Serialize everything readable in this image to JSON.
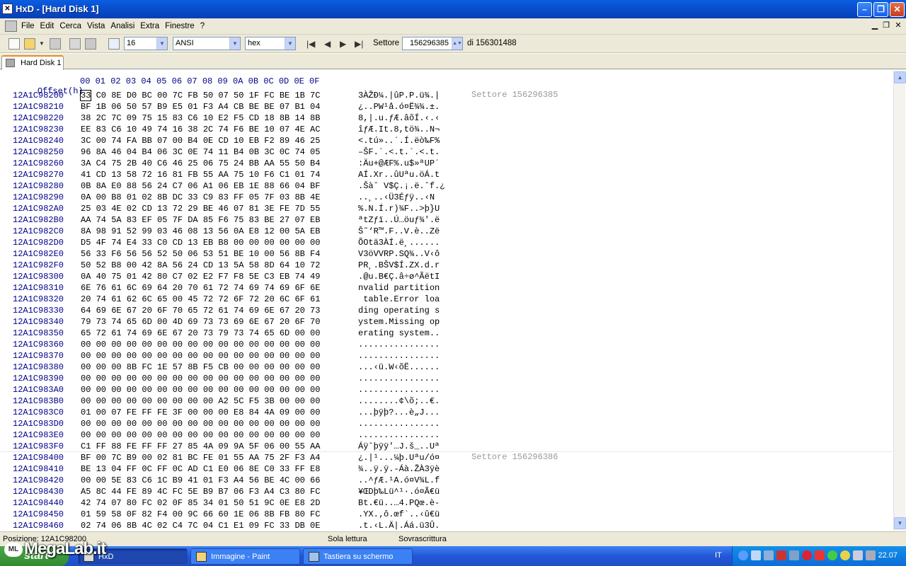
{
  "window": {
    "title": "HxD - [Hard Disk 1]",
    "app_icon": "hxd-icon"
  },
  "menu": [
    "File",
    "Edit",
    "Cerca",
    "Vista",
    "Analisi",
    "Extra",
    "Finestre",
    "?"
  ],
  "toolbar": {
    "bytes_per_row": "16",
    "charset": "ANSI",
    "offset_base": "hex",
    "sector_label": "Settore",
    "sector_value": "156296385",
    "sector_total": "di 156301488"
  },
  "tab": {
    "label": "Hard Disk 1"
  },
  "editor": {
    "offset_header": "Offset(h)",
    "columns": "00 01 02 03 04 05 06 07 08 09 0A 0B 0C 0D 0E 0F",
    "sector1_label": "Settore 156296385",
    "sector2_label": "Settore 156296386",
    "rows": [
      {
        "off": "12A1C98200",
        "hex": "33 C0 8E D0 BC 00 7C FB 50 07 50 1F FC BE 1B 7C",
        "asc": "3ÀŽÐ¼.|ûP.P.ü¾.|"
      },
      {
        "off": "12A1C98210",
        "hex": "BF 1B 06 50 57 B9 E5 01 F3 A4 CB BE BE 07 B1 04",
        "asc": "¿..PW¹å.ó¤Ë¾¾.±."
      },
      {
        "off": "12A1C98220",
        "hex": "38 2C 7C 09 75 15 83 C6 10 E2 F5 CD 18 8B 14 8B",
        "asc": "8,|.u.ƒÆ.âõÍ.‹.‹"
      },
      {
        "off": "12A1C98230",
        "hex": "EE 83 C6 10 49 74 16 38 2C 74 F6 BE 10 07 4E AC",
        "asc": "îƒÆ.It.8,tö¾..N¬"
      },
      {
        "off": "12A1C98240",
        "hex": "3C 00 74 FA BB 07 00 B4 0E CD 10 EB F2 89 46 25",
        "asc": "<.tú»..´.Í.ëò‰F%"
      },
      {
        "off": "12A1C98250",
        "hex": "96 8A 46 04 B4 06 3C 0E 74 11 B4 0B 3C 0C 74 05",
        "asc": "–ŠF.´.<.t.´.<.t."
      },
      {
        "off": "12A1C98260",
        "hex": "3A C4 75 2B 40 C6 46 25 06 75 24 BB AA 55 50 B4",
        "asc": ":Äu+@ÆF%.u$»ªUP´"
      },
      {
        "off": "12A1C98270",
        "hex": "41 CD 13 58 72 16 81 FB 55 AA 75 10 F6 C1 01 74",
        "asc": "AÍ.Xr..ûUªu.öÁ.t"
      },
      {
        "off": "12A1C98280",
        "hex": "0B 8A E0 88 56 24 C7 06 A1 06 EB 1E 88 66 04 BF",
        "asc": ".Šàˆ V$Ç.¡.ë.ˆf.¿"
      },
      {
        "off": "12A1C98290",
        "hex": "0A 00 B8 01 02 8B DC 33 C9 83 FF 05 7F 03 8B 4E",
        "asc": "..¸..‹Ü3Éƒÿ..‹N"
      },
      {
        "off": "12A1C982A0",
        "hex": "25 03 4E 02 CD 13 72 29 BE 46 07 81 3E FE 7D 55",
        "asc": "%.N.Í.r)¾F..>þ}U"
      },
      {
        "off": "12A1C982B0",
        "hex": "AA 74 5A 83 EF 05 7F DA 85 F6 75 83 BE 27 07 EB",
        "asc": "ªtZƒï..Ú…öuƒ¾'.ë"
      },
      {
        "off": "12A1C982C0",
        "hex": "8A 98 91 52 99 03 46 08 13 56 0A E8 12 00 5A EB",
        "asc": "Š˜‘R™.F..V.è..Zë"
      },
      {
        "off": "12A1C982D0",
        "hex": "D5 4F 74 E4 33 C0 CD 13 EB B8 00 00 00 00 00 00",
        "asc": "ÕOtä3ÀÍ.ë¸......"
      },
      {
        "off": "12A1C982E0",
        "hex": "56 33 F6 56 56 52 50 06 53 51 BE 10 00 56 8B F4",
        "asc": "V3öVVRP.SQ¾..V‹ô"
      },
      {
        "off": "12A1C982F0",
        "hex": "50 52 B8 00 42 8A 56 24 CD 13 5A 58 8D 64 10 72",
        "asc": "PR¸.BŠV$Í.ZX.d.r"
      },
      {
        "off": "12A1C98300",
        "hex": "0A 40 75 01 42 80 C7 02 E2 F7 F8 5E C3 EB 74 49",
        "asc": ".@u.B€Ç.â÷ø^ÃëtI"
      },
      {
        "off": "12A1C98310",
        "hex": "6E 76 61 6C 69 64 20 70 61 72 74 69 74 69 6F 6E",
        "asc": "nvalid partition"
      },
      {
        "off": "12A1C98320",
        "hex": "20 74 61 62 6C 65 00 45 72 72 6F 72 20 6C 6F 61",
        "asc": " table.Error loa"
      },
      {
        "off": "12A1C98330",
        "hex": "64 69 6E 67 20 6F 70 65 72 61 74 69 6E 67 20 73",
        "asc": "ding operating s"
      },
      {
        "off": "12A1C98340",
        "hex": "79 73 74 65 6D 00 4D 69 73 73 69 6E 67 20 6F 70",
        "asc": "ystem.Missing op"
      },
      {
        "off": "12A1C98350",
        "hex": "65 72 61 74 69 6E 67 20 73 79 73 74 65 6D 00 00",
        "asc": "erating system.."
      },
      {
        "off": "12A1C98360",
        "hex": "00 00 00 00 00 00 00 00 00 00 00 00 00 00 00 00",
        "asc": "................"
      },
      {
        "off": "12A1C98370",
        "hex": "00 00 00 00 00 00 00 00 00 00 00 00 00 00 00 00",
        "asc": "................"
      },
      {
        "off": "12A1C98380",
        "hex": "00 00 00 8B FC 1E 57 8B F5 CB 00 00 00 00 00 00",
        "asc": "...‹ü.W‹õË......"
      },
      {
        "off": "12A1C98390",
        "hex": "00 00 00 00 00 00 00 00 00 00 00 00 00 00 00 00",
        "asc": "................"
      },
      {
        "off": "12A1C983A0",
        "hex": "00 00 00 00 00 00 00 00 00 00 00 00 00 00 00 00",
        "asc": "................"
      },
      {
        "off": "12A1C983B0",
        "hex": "00 00 00 00 00 00 00 00 00 A2 5C F5 3B 00 00 00",
        "asc": "........¢\\õ;..€."
      },
      {
        "off": "12A1C983C0",
        "hex": "01 00 07 FE FF FE 3F 00 00 00 E8 84 4A 09 00 00",
        "asc": "...þÿþ?...è„J..."
      },
      {
        "off": "12A1C983D0",
        "hex": "00 00 00 00 00 00 00 00 00 00 00 00 00 00 00 00",
        "asc": "................"
      },
      {
        "off": "12A1C983E0",
        "hex": "00 00 00 00 00 00 00 00 00 00 00 00 00 00 00 00",
        "asc": "................"
      },
      {
        "off": "12A1C983F0",
        "hex": "C1 FF 88 FE FF FF 27 85 4A 09 9A 5F 06 00 55 AA",
        "asc": "Áÿˆþÿÿ'…J.š_..Uª"
      },
      {
        "off": "12A1C98400",
        "hex": "BF 00 7C B9 00 02 81 BC FE 01 55 AA 75 2F F3 A4",
        "asc": "¿.|¹...¼þ.Uªu/ó¤"
      },
      {
        "off": "12A1C98410",
        "hex": "BE 13 04 FF 0C FF 0C AD C1 E0 06 8E C0 33 FF E8",
        "asc": "¾..ÿ.ÿ.-Áà.ŽÀ3ÿè"
      },
      {
        "off": "12A1C98420",
        "hex": "00 00 5E 83 C6 1C B9 41 01 F3 A4 56 BE 4C 00 66",
        "asc": "..^ƒÆ.¹A.ó¤V¾L.f"
      },
      {
        "off": "12A1C98430",
        "hex": "A5 8C 44 FE 89 4C FC 5E B9 B7 06 F3 A4 C3 80 FC",
        "asc": "¥ŒDþ‰Lü^¹·.ó¤Ã€ü"
      },
      {
        "off": "12A1C98440",
        "hex": "42 74 07 80 FC 02 0F 85 34 01 50 51 9C 0E E8 2D",
        "asc": "Bt.€ü..…4.PQœ.è-"
      },
      {
        "off": "12A1C98450",
        "hex": "01 59 58 0F 82 F4 00 9C 66 60 1E 06 8B FB 80 FC",
        "asc": ".YX.‚ô.œf`..‹û€ü"
      },
      {
        "off": "12A1C98460",
        "hex": "02 74 06 8B 4C 02 C4 7C 04 C1 E1 09 FC 33 DB 0E",
        "asc": ".t.‹L.Ä|.Áá.ü3Û."
      }
    ]
  },
  "status": {
    "position": "Posizione: 12A1C98200",
    "mode": "Sola lettura",
    "overwrite": "Sovrascrittura"
  },
  "taskbar": {
    "start": "start",
    "buttons": [
      "HxD",
      "Immagine - Paint",
      "Tastiera su schermo"
    ],
    "lang": "IT",
    "clock": "22.07"
  },
  "watermark": "MegaLab.it"
}
